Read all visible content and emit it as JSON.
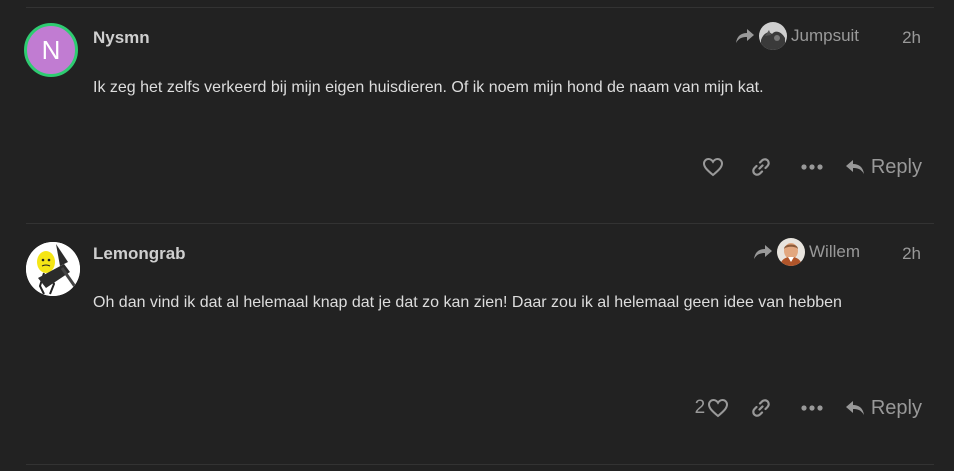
{
  "posts": [
    {
      "username": "Nysmn",
      "avatar_letter": "N",
      "avatar_color": "#c17cd2",
      "avatar_ring": "#2ecc71",
      "reply_to_user": "Jumpsuit",
      "time": "2h",
      "body": "Ik zeg het zelfs verkeerd bij mijn eigen huisdieren. Of ik noem mijn hond de naam van mijn kat.",
      "like_count": "",
      "reply_label": "Reply"
    },
    {
      "username": "Lemongrab",
      "reply_to_user": "Willem",
      "time": "2h",
      "body": "Oh dan vind ik dat al helemaal knap dat je dat zo kan zien! Daar zou ik al helemaal geen idee van hebben",
      "like_count": "2",
      "reply_label": "Reply"
    }
  ],
  "icons": {
    "like": "heart-icon",
    "link": "link-icon",
    "more": "ellipsis-icon",
    "reply": "reply-arrow-icon",
    "reply_to": "share-arrow-icon"
  }
}
